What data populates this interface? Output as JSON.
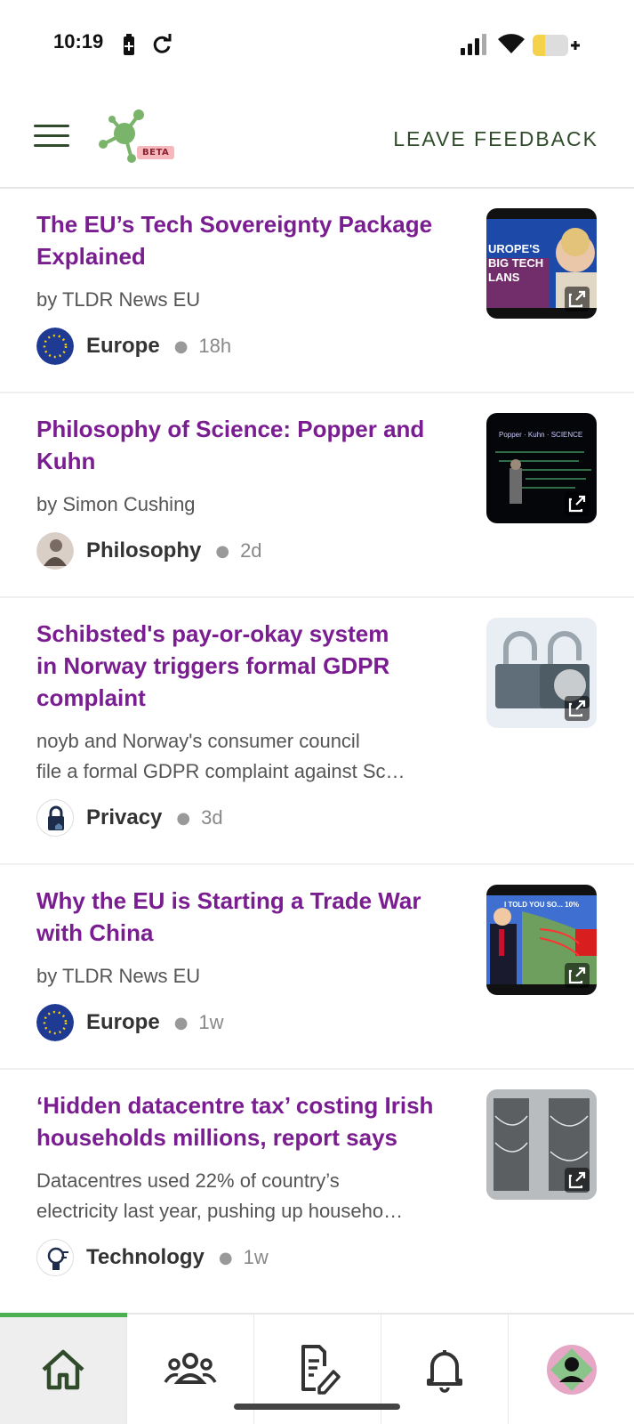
{
  "status_bar": {
    "time": "10:19",
    "icons": [
      "battery-saver-icon",
      "sync-icon",
      "signal-icon",
      "wifi-icon",
      "battery-icon"
    ]
  },
  "header": {
    "logo_badge": "BETA",
    "feedback_label": "LEAVE FEEDBACK",
    "menu_icon": "hamburger-menu-icon"
  },
  "feed": {
    "items": [
      {
        "title_lines": [
          "The EU’s Tech Sovereignty Package",
          "Explained"
        ],
        "subtitle_lines": [
          "by TLDR News EU"
        ],
        "topic": "Europe",
        "time": "18h",
        "thumb_text": "UROPE'S BIG TECH LANS"
      },
      {
        "title_lines": [
          "Philosophy of Science: Popper and",
          "Kuhn"
        ],
        "subtitle_lines": [
          "by Simon Cushing"
        ],
        "topic": "Philosophy",
        "time": "2d",
        "thumb_text": "Popper · Kuhn · SCIENCE"
      },
      {
        "title_lines": [
          "Schibsted's pay-or-okay system",
          "in Norway triggers formal GDPR",
          "complaint"
        ],
        "subtitle_lines": [
          "noyb and Norway's consumer council",
          "file a formal GDPR complaint against Sc…"
        ],
        "topic": "Privacy",
        "time": "3d",
        "thumb_text": ""
      },
      {
        "title_lines": [
          "Why the EU is Starting a Trade War",
          "with China"
        ],
        "subtitle_lines": [
          "by TLDR News EU"
        ],
        "topic": "Europe",
        "time": "1w",
        "thumb_text": "I TOLD YOU SO... 10%"
      },
      {
        "title_lines": [
          "‘Hidden datacentre tax’ costing Irish",
          "households millions, report says"
        ],
        "subtitle_lines": [
          "Datacentres used 22% of country’s",
          "electricity last year, pushing up househo…"
        ],
        "topic": "Technology",
        "time": "1w",
        "thumb_text": ""
      }
    ]
  },
  "bottom_nav": {
    "tabs": [
      "home-icon",
      "groups-icon",
      "edit-note-icon",
      "notifications-icon",
      "profile-avatar"
    ],
    "active": "home-icon"
  },
  "colors": {
    "title": "#7a1d91",
    "accent": "#4caf50",
    "logo_green": "#7ab36a",
    "nav_dark": "#2f4b2a"
  }
}
